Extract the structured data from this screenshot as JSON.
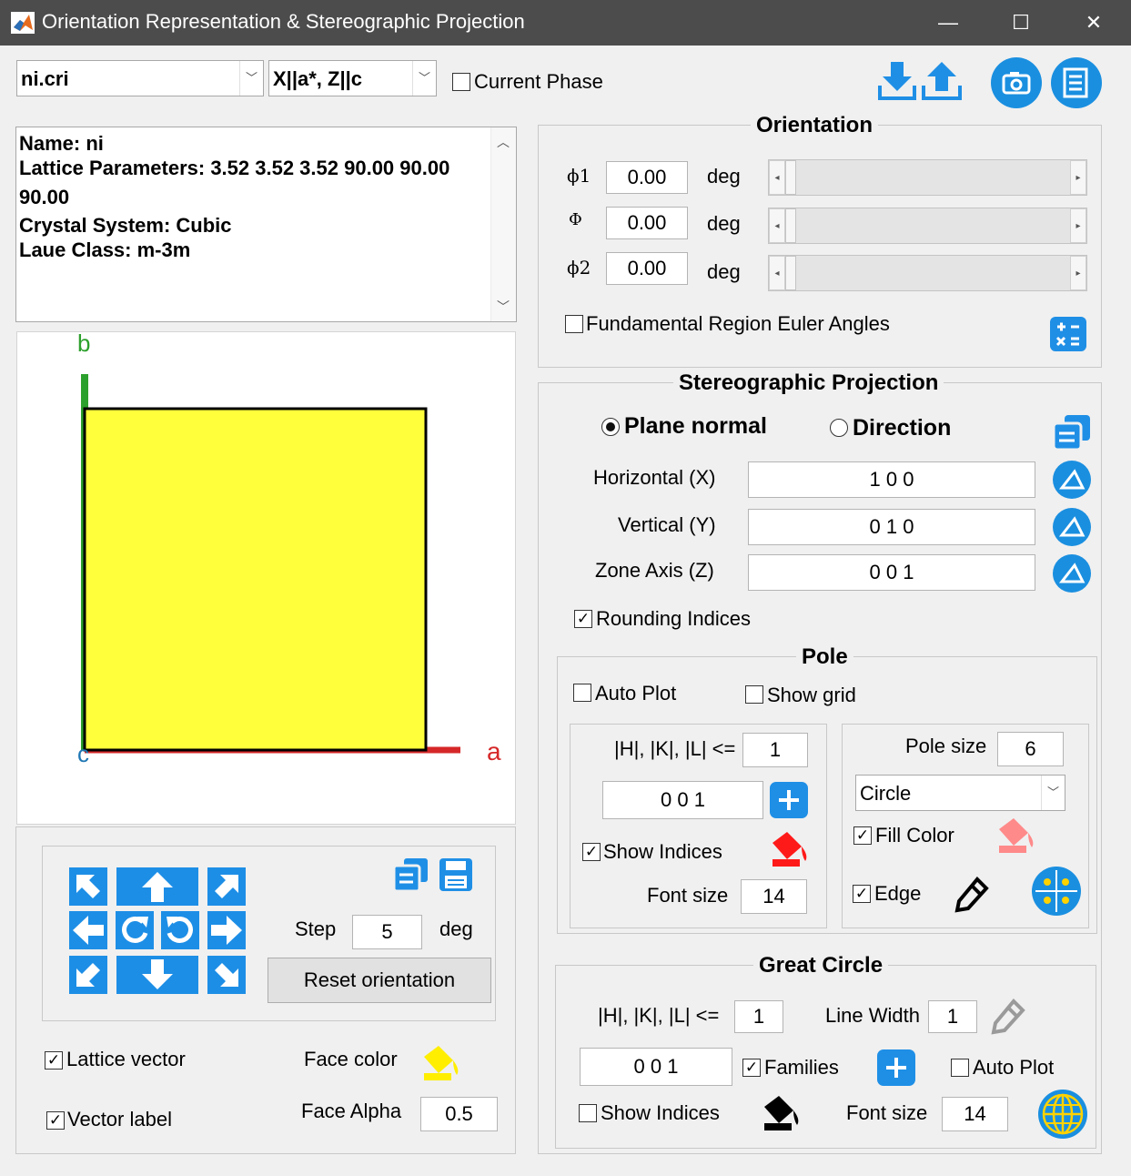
{
  "window": {
    "title": "Orientation Representation & Stereographic Projection",
    "min": "—",
    "max": "☐",
    "close": "✕"
  },
  "top": {
    "file_select": "ni.cri",
    "frame_select": "X||a*, Z||c",
    "current_phase_label": "Current Phase"
  },
  "info": {
    "lines": [
      "Name: ni",
      "Lattice Parameters: 3.52 3.52 3.52 90.00 90.00",
      "90.00",
      "Crystal System: Cubic",
      "Laue Class: m-3m"
    ]
  },
  "view": {
    "axis_a": "a",
    "axis_b": "b",
    "axis_c": "c",
    "face_fill": "#ffff3c",
    "axis_a_color": "#d62728",
    "axis_b_color": "#2ca02c",
    "axis_c_color": "#1f77b4"
  },
  "rotation": {
    "step_label": "Step",
    "step_value": "5",
    "step_unit": "deg",
    "reset_label": "Reset orientation"
  },
  "bottom_left": {
    "lattice_vector_label": "Lattice vector",
    "vector_label_label": "Vector label",
    "face_color_label": "Face color",
    "face_alpha_label": "Face Alpha",
    "face_alpha_value": "0.5"
  },
  "orientation": {
    "title": "Orientation",
    "rows": [
      {
        "symbol": "ϕ1",
        "value": "0.00",
        "unit": "deg"
      },
      {
        "symbol": "Φ",
        "value": "0.00",
        "unit": "deg"
      },
      {
        "symbol": "ϕ2",
        "value": "0.00",
        "unit": "deg"
      }
    ],
    "fundamental_label": "Fundamental Region Euler Angles"
  },
  "stereo": {
    "title": "Stereographic Projection",
    "plane_normal": "Plane normal",
    "direction": "Direction",
    "horizontal_label": "Horizontal (X)",
    "horizontal_value": "1 0 0",
    "vertical_label": "Vertical (Y)",
    "vertical_value": "0 1 0",
    "zone_label": "Zone Axis (Z)",
    "zone_value": "0 0 1",
    "rounding_label": "Rounding Indices"
  },
  "pole": {
    "title": "Pole",
    "auto_plot": "Auto Plot",
    "show_grid": "Show grid",
    "hkl_label": "|H|, |K|, |L| <=",
    "hkl_value": "1",
    "index_value": "0 0 1",
    "show_indices": "Show Indices",
    "font_size_label": "Font size",
    "font_size_value": "14",
    "pole_size_label": "Pole size",
    "pole_size_value": "6",
    "marker": "Circle",
    "fill_color": "Fill Color",
    "edge": "Edge"
  },
  "great_circle": {
    "title": "Great Circle",
    "hkl_label": "|H|, |K|, |L| <=",
    "hkl_value": "1",
    "line_width_label": "Line Width",
    "line_width_value": "1",
    "index_value": "0 0 1",
    "families": "Families",
    "auto_plot": "Auto Plot",
    "show_indices": "Show Indices",
    "font_size_label": "Font size",
    "font_size_value": "14"
  }
}
